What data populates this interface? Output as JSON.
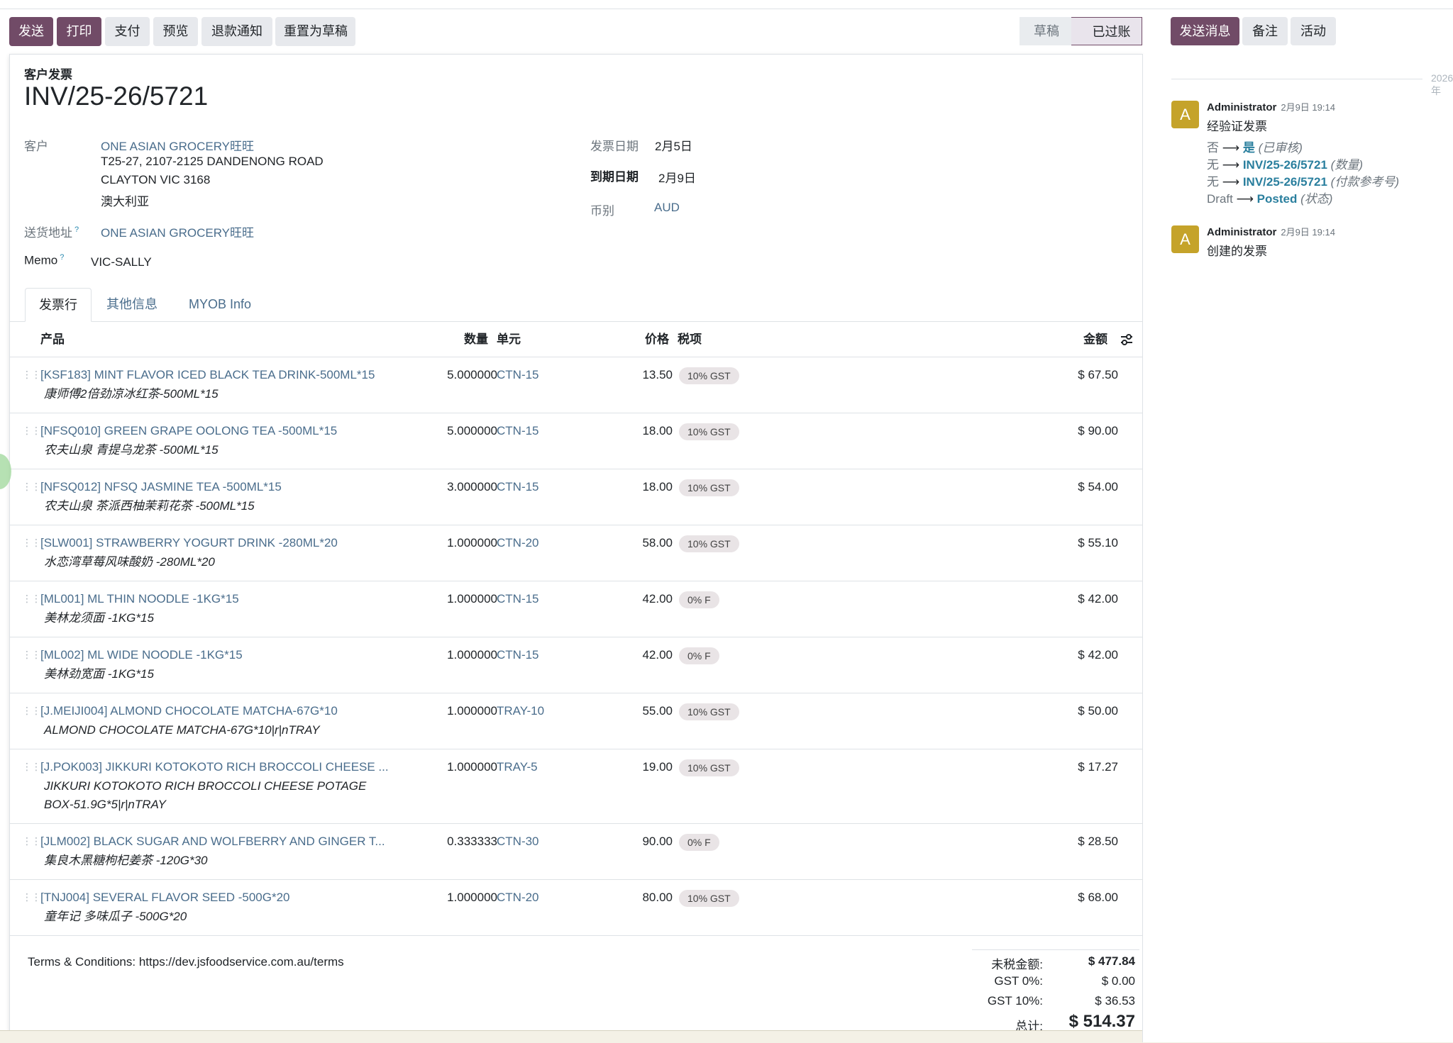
{
  "toolbar": {
    "send": "发送",
    "print": "打印",
    "pay": "支付",
    "preview": "预览",
    "credit_note": "退款通知",
    "reset_draft": "重置为草稿"
  },
  "status": {
    "draft": "草稿",
    "posted": "已过账"
  },
  "chatter_buttons": {
    "send_message": "发送消息",
    "log_note": "备注",
    "activity": "活动"
  },
  "form": {
    "doc_type": "客户发票",
    "title": "INV/25-26/5721",
    "customer_label": "客户",
    "customer_name": "ONE ASIAN GROCERY旺旺",
    "address_line1": "T25-27, 2107-2125 DANDENONG ROAD",
    "address_line2": "CLAYTON VIC 3168",
    "address_line3": "澳大利亚",
    "delivery_label": "送货地址",
    "delivery_value": "ONE ASIAN GROCERY旺旺",
    "memo_label": "Memo",
    "memo_value": "VIC-SALLY",
    "help_mark": "?",
    "invoice_date_label": "发票日期",
    "invoice_date": "2月5日",
    "due_date_label": "到期日期",
    "due_date": "2月9日",
    "currency_label": "币别",
    "currency": "AUD"
  },
  "tabs": {
    "lines": "发票行",
    "other": "其他信息",
    "myob": "MYOB Info"
  },
  "table": {
    "headers": {
      "product": "产品",
      "qty": "数量",
      "unit": "单元",
      "price": "价格",
      "tax": "税项",
      "amount": "金额"
    },
    "rows": [
      {
        "name": "[KSF183] MINT FLAVOR ICED BLACK TEA DRINK-500ML*15",
        "desc1": "康师傅2倍劲凉冰红茶-500ML*15",
        "desc2": "",
        "qty": "5.000000",
        "unit": "CTN-15",
        "price": "13.50",
        "tax": "10% GST",
        "amount": "$ 67.50"
      },
      {
        "name": "[NFSQ010] GREEN GRAPE OOLONG TEA -500ML*15",
        "desc1": "农夫山泉 青提乌龙茶 -500ML*15",
        "desc2": "",
        "qty": "5.000000",
        "unit": "CTN-15",
        "price": "18.00",
        "tax": "10% GST",
        "amount": "$ 90.00"
      },
      {
        "name": "[NFSQ012] NFSQ JASMINE TEA -500ML*15",
        "desc1": "农夫山泉 茶派西柚茉莉花茶 -500ML*15",
        "desc2": "",
        "qty": "3.000000",
        "unit": "CTN-15",
        "price": "18.00",
        "tax": "10% GST",
        "amount": "$ 54.00"
      },
      {
        "name": "[SLW001] STRAWBERRY YOGURT DRINK -280ML*20",
        "desc1": "水恋湾草莓风味酸奶 -280ML*20",
        "desc2": "",
        "qty": "1.000000",
        "unit": "CTN-20",
        "price": "58.00",
        "tax": "10% GST",
        "amount": "$ 55.10"
      },
      {
        "name": "[ML001] ML THIN NOODLE -1KG*15",
        "desc1": "美林龙须面 -1KG*15",
        "desc2": "",
        "qty": "1.000000",
        "unit": "CTN-15",
        "price": "42.00",
        "tax": "0% F",
        "amount": "$ 42.00"
      },
      {
        "name": "[ML002] ML WIDE NOODLE -1KG*15",
        "desc1": "美林劲宽面 -1KG*15",
        "desc2": "",
        "qty": "1.000000",
        "unit": "CTN-15",
        "price": "42.00",
        "tax": "0% F",
        "amount": "$ 42.00"
      },
      {
        "name": "[J.MEIJI004] ALMOND CHOCOLATE MATCHA-67G*10",
        "desc1": "ALMOND CHOCOLATE MATCHA-67G*10|r|nTRAY",
        "desc2": "",
        "qty": "1.000000",
        "unit": "TRAY-10",
        "price": "55.00",
        "tax": "10% GST",
        "amount": "$ 50.00"
      },
      {
        "name": "[J.POK003] JIKKURI KOTOKOTO RICH BROCCOLI CHEESE ...",
        "desc1": "JIKKURI KOTOKOTO RICH BROCCOLI CHEESE POTAGE",
        "desc2": "BOX-51.9G*5|r|nTRAY",
        "qty": "1.000000",
        "unit": "TRAY-5",
        "price": "19.00",
        "tax": "10% GST",
        "amount": "$ 17.27"
      },
      {
        "name": "[JLM002] BLACK SUGAR AND WOLFBERRY AND GINGER T...",
        "desc1": "集良木黑糖枸杞姜茶 -120G*30",
        "desc2": "",
        "qty": "0.333333",
        "unit": "CTN-30",
        "price": "90.00",
        "tax": "0% F",
        "amount": "$ 28.50"
      },
      {
        "name": "[TNJ004] SEVERAL FLAVOR SEED -500G*20",
        "desc1": "童年记 多味瓜子 -500G*20",
        "desc2": "",
        "qty": "1.000000",
        "unit": "CTN-20",
        "price": "80.00",
        "tax": "10% GST",
        "amount": "$ 68.00"
      }
    ]
  },
  "footer": {
    "terms": "Terms & Conditions: https://dev.jsfoodservice.com.au/terms",
    "untaxed_label": "未税金额:",
    "untaxed": "$ 477.84",
    "gst0_label": "GST 0%:",
    "gst0": "$ 0.00",
    "gst10_label": "GST 10%:",
    "gst10": "$ 36.53",
    "total_label": "总计:",
    "total": "$ 514.37"
  },
  "chatter": {
    "date": "2026年",
    "messages": [
      {
        "initial": "A",
        "author": "Administrator",
        "time": "2月9日 19:14",
        "body": "经验证发票",
        "tracking": [
          {
            "old": "否",
            "new": "是",
            "field": "(已审核)"
          },
          {
            "old": "无",
            "new": "INV/25-26/5721",
            "field": "(数量)"
          },
          {
            "old": "无",
            "new": "INV/25-26/5721",
            "field": "(付款参考号)"
          },
          {
            "old": "Draft",
            "new": "Posted",
            "field": "(状态)"
          }
        ]
      },
      {
        "initial": "A",
        "author": "Administrator",
        "time": "2月9日 19:14",
        "body": "创建的发票"
      }
    ]
  },
  "colors": {
    "primary": "#714b67",
    "link": "#4a6d8c",
    "tracking_new": "#2a7f9e",
    "avatar": "#c5a32a"
  }
}
